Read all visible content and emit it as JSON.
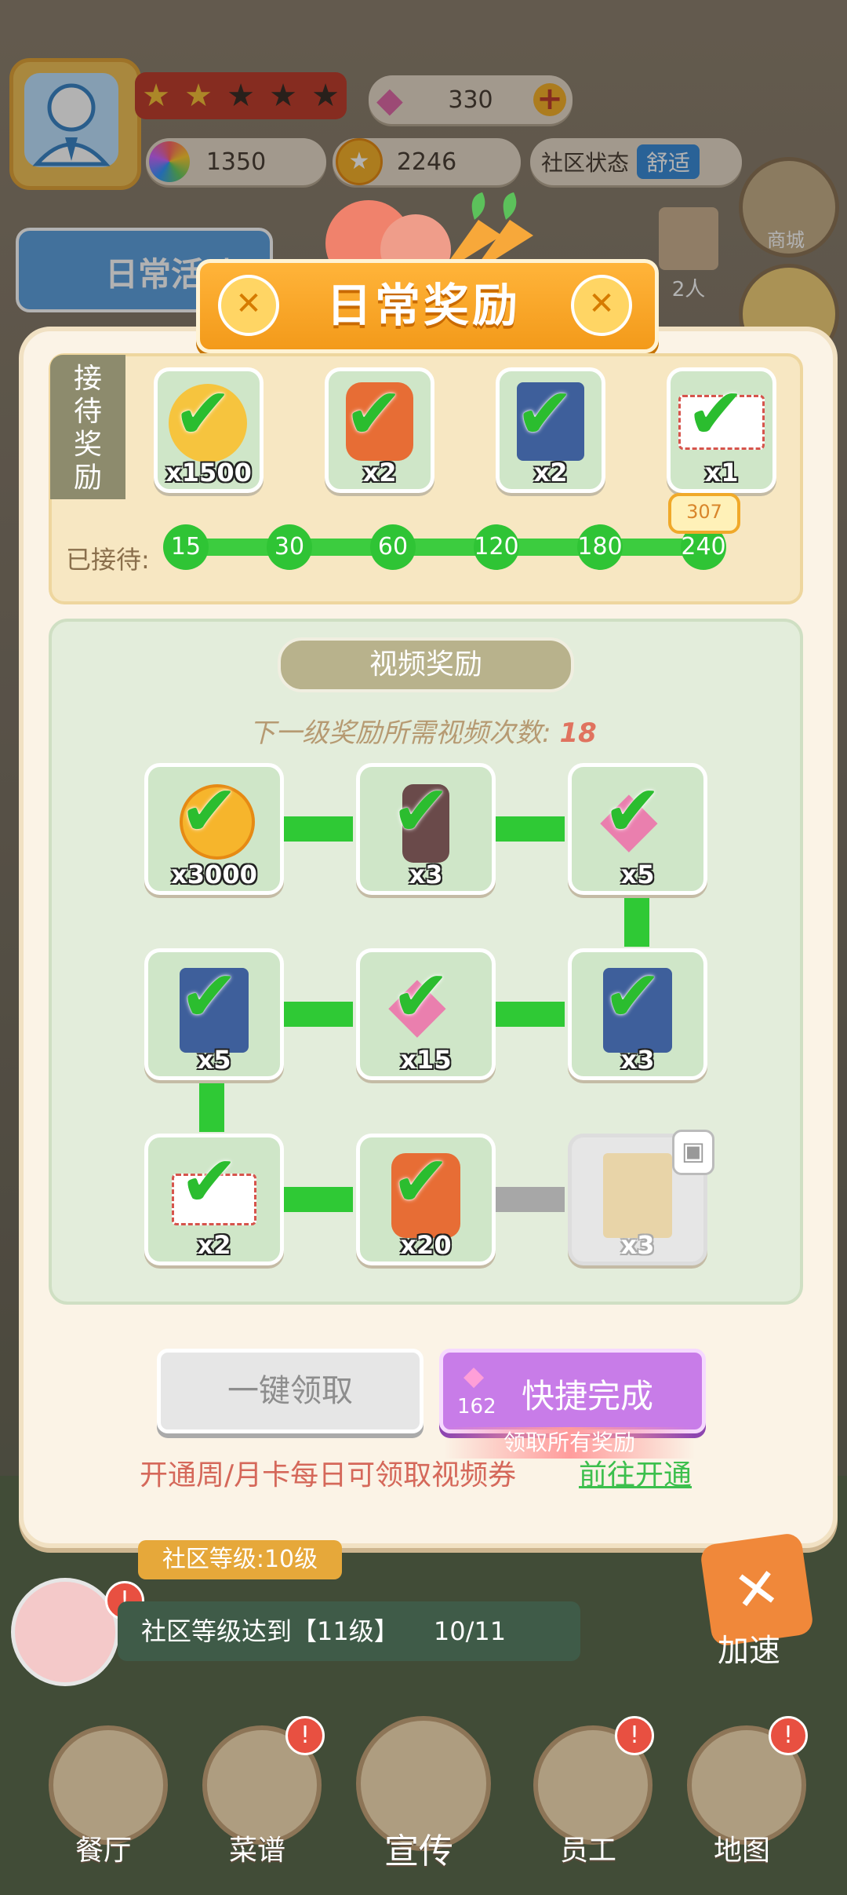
{
  "hud": {
    "diamonds": "330",
    "currency_a": "1350",
    "coins": "2246",
    "community_status_label": "社区状态",
    "community_status_value": "舒适",
    "stars_filled": 1.5,
    "stars_total": 5
  },
  "side": {
    "daily_activity": "日常活动",
    "shop": "商城",
    "people": "2人"
  },
  "dialog": {
    "title": "日常奖励",
    "reception": {
      "side_label": "接待奖励",
      "rewards": [
        {
          "icon": "coin-icon",
          "qty": "x1500"
        },
        {
          "icon": "seed-bag-icon",
          "qty": "x2"
        },
        {
          "icon": "blue-book-icon",
          "qty": "x2"
        },
        {
          "icon": "envelope-icon",
          "qty": "x1"
        }
      ],
      "progress_label": "已接待:",
      "milestones": [
        "15",
        "30",
        "60",
        "120",
        "180",
        "240"
      ],
      "current": "307"
    },
    "video": {
      "title": "视频奖励",
      "subtitle": "下一级奖励所需视频次数:",
      "subtitle_count": "18",
      "rewards": [
        {
          "icon": "gold-coin-icon",
          "qty": "x3000",
          "claimed": true
        },
        {
          "icon": "jar-icon",
          "qty": "x3",
          "claimed": true
        },
        {
          "icon": "pink-diamond-icon",
          "qty": "x5",
          "claimed": true
        },
        {
          "icon": "blue-book-icon",
          "qty": "x5",
          "claimed": true
        },
        {
          "icon": "pink-diamond-icon",
          "qty": "x15",
          "claimed": true
        },
        {
          "icon": "blue-book-icon",
          "qty": "x3",
          "claimed": true
        },
        {
          "icon": "envelope-icon",
          "qty": "x2",
          "claimed": true
        },
        {
          "icon": "seed-bag-icon",
          "qty": "x20",
          "claimed": true
        },
        {
          "icon": "parcel-icon",
          "qty": "x3",
          "claimed": false
        }
      ]
    },
    "buttons": {
      "claim_all": "一键领取",
      "quick_finish": "快捷完成",
      "quick_cost": "162",
      "quick_hint": "领取所有奖励"
    },
    "footer_text": "开通周/月卡每日可领取视频券",
    "footer_link": "前往开通"
  },
  "bottom": {
    "community_level": "社区等级:10级",
    "task_text": "社区等级达到【11级】",
    "task_progress": "10/11",
    "speedup": "加速",
    "nav": [
      "餐厅",
      "菜谱",
      "宣传",
      "员工",
      "地图"
    ]
  },
  "colors": {
    "accent_green": "#2fc935",
    "banner_orange": "#f39a1a",
    "purple_button": "#c87ce8"
  }
}
